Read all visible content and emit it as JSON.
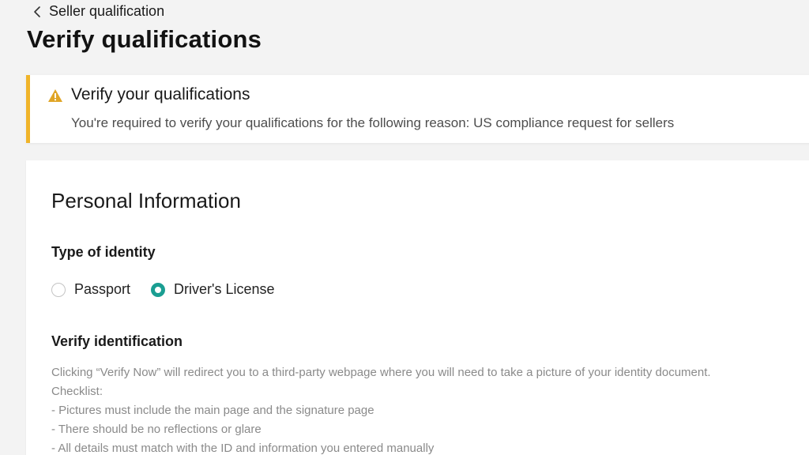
{
  "nav": {
    "back_label": "Seller qualification"
  },
  "page": {
    "title": "Verify qualifications"
  },
  "alert": {
    "icon": "warning-triangle-icon",
    "accent_color": "#f0b429",
    "title": "Verify your qualifications",
    "message": "You're required to verify your qualifications for the following reason: US compliance request for sellers"
  },
  "personal_info": {
    "section_title": "Personal Information",
    "identity_type": {
      "label": "Type of identity",
      "options": [
        {
          "label": "Passport",
          "selected": false
        },
        {
          "label": "Driver's License",
          "selected": true
        }
      ],
      "selected_color": "#1a9e92"
    },
    "verify": {
      "label": "Verify identification",
      "lines": [
        "Clicking “Verify Now” will redirect you to a third-party webpage where you will need to take a picture of your identity document.",
        "Checklist:",
        "- Pictures must include the main page and the signature page",
        "- There should be no reflections or glare",
        "- All details must match with the ID and information you entered manually"
      ]
    }
  }
}
